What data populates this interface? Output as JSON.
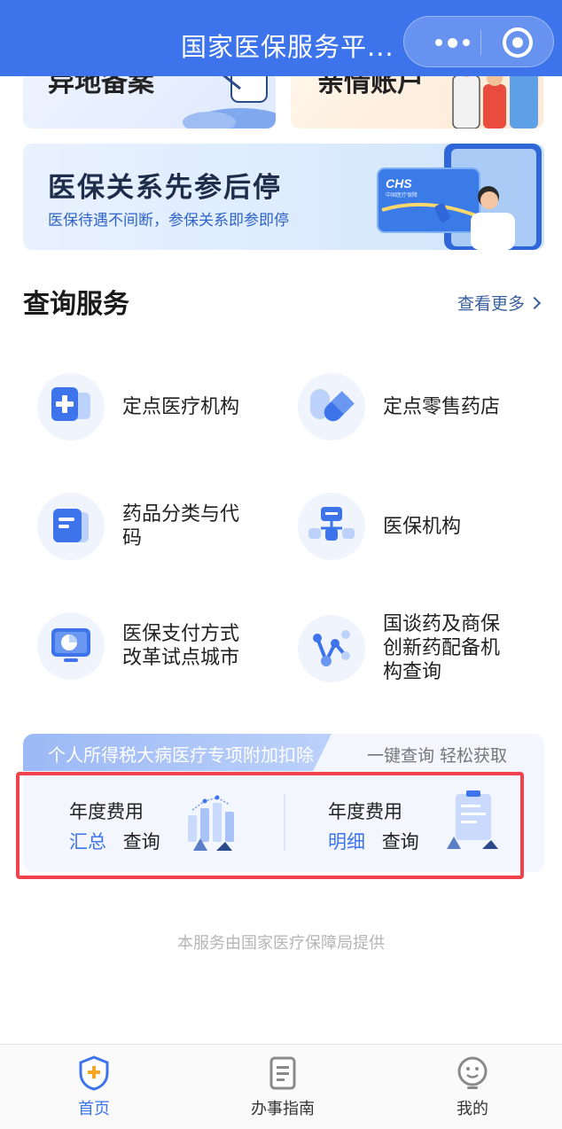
{
  "header": {
    "title": "国家医保服务平...",
    "more_icon": "more-dots-icon",
    "close_icon": "target-circle-icon",
    "bar_color": "#3d74ec"
  },
  "top_cards": [
    {
      "text": "异地备案"
    },
    {
      "text": "亲情账户"
    }
  ],
  "banner": {
    "title": "医保关系先参后停",
    "subtitle": "医保待遇不间断，参保关系即参即停",
    "card_logo": "CHS",
    "card_logo_sub": "中国医疗保障"
  },
  "query_section": {
    "title": "查询服务",
    "see_more": "查看更多",
    "items": [
      {
        "label": "定点医疗机构",
        "icon": "hospital-plus-icon"
      },
      {
        "label": "定点零售药店",
        "icon": "pill-capsule-icon"
      },
      {
        "label": "药品分类与代码",
        "icon": "document-list-icon"
      },
      {
        "label": "医保机构",
        "icon": "org-structure-icon"
      },
      {
        "label": "医保支付方式改革试点城市",
        "icon": "monitor-chart-icon"
      },
      {
        "label": "国谈药及商保创新药配备机构查询",
        "icon": "network-nodes-icon"
      }
    ]
  },
  "tax": {
    "tag": "个人所得税大病医疗专项附加扣除",
    "slogan": "一键查询 轻松获取",
    "summary": {
      "line1": "年度费用",
      "highlight": "汇总",
      "action": "查询"
    },
    "detail": {
      "line1": "年度费用",
      "highlight": "明细",
      "action": "查询"
    }
  },
  "footer_note": "本服务由国家医疗保障局提供",
  "tabbar": {
    "items": [
      {
        "label": "首页",
        "icon": "home-shield-icon",
        "active": true
      },
      {
        "label": "办事指南",
        "icon": "guide-document-icon",
        "active": false
      },
      {
        "label": "我的",
        "icon": "smile-face-icon",
        "active": false
      }
    ],
    "active_color": "#3d74ec"
  }
}
